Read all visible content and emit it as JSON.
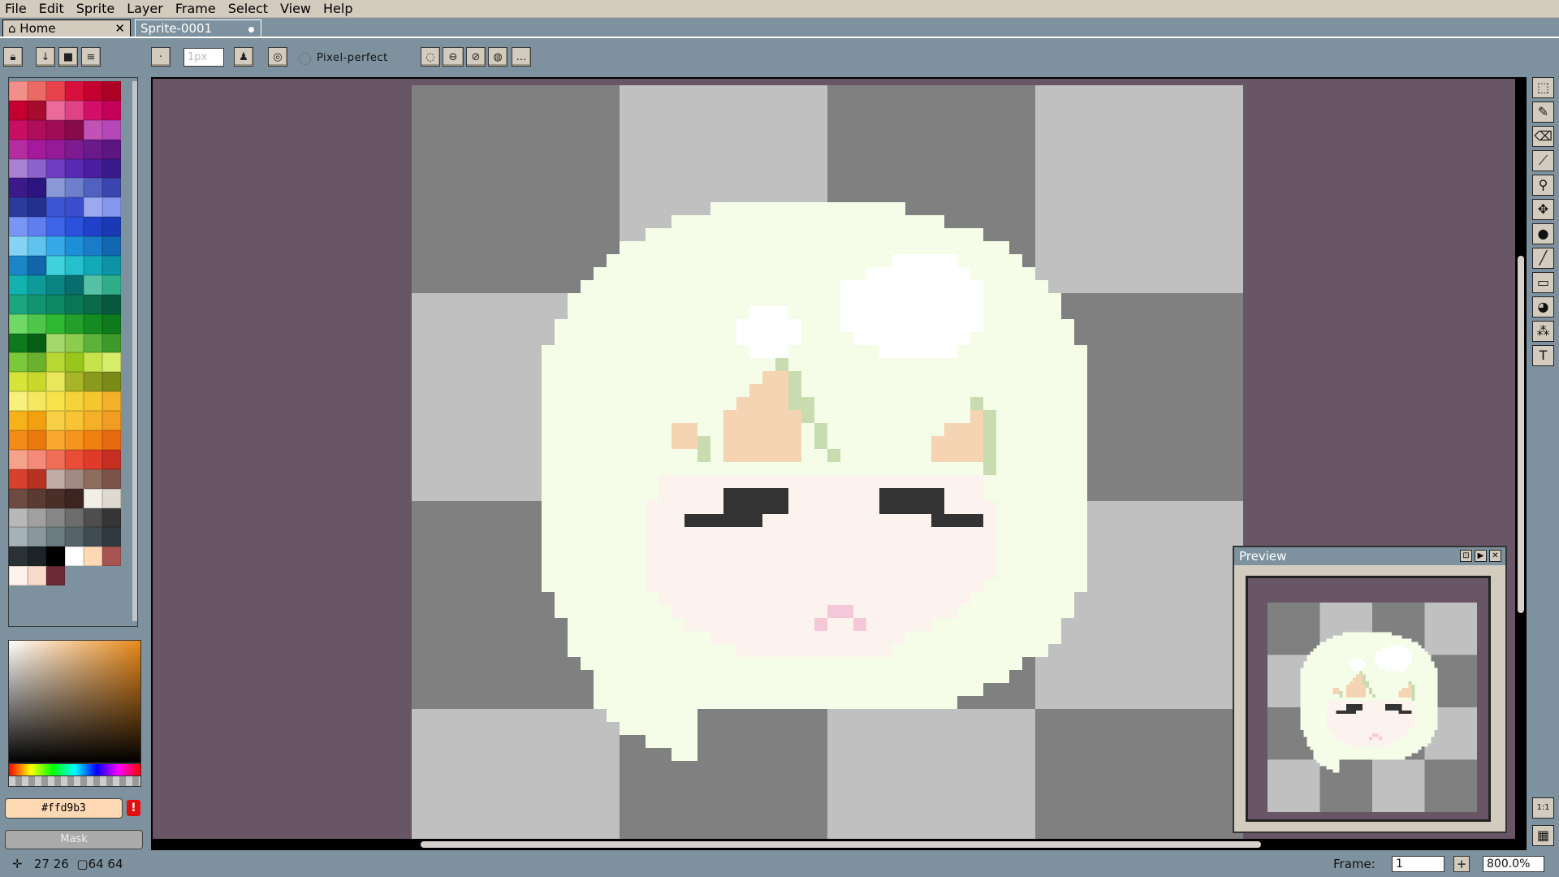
{
  "menu": [
    "File",
    "Edit",
    "Sprite",
    "Layer",
    "Frame",
    "Select",
    "View",
    "Help"
  ],
  "tabs": {
    "home": "Home",
    "home_close": "✕",
    "sprite": "Sprite-0001"
  },
  "toolbar": {
    "brush_size": "1px",
    "pixel_perfect": "Pixel-perfect",
    "lock_icon": "lock-icon",
    "more": "..."
  },
  "palette": {
    "colors": [
      "#f38f8a",
      "#ec6a66",
      "#e9424d",
      "#d9103b",
      "#c3002f",
      "#ac0024",
      "#c3002f",
      "#a70c2e",
      "#ec6a9a",
      "#e04286",
      "#d20f68",
      "#c3005a",
      "#c80f63",
      "#b00d5c",
      "#a00c56",
      "#870a4a",
      "#c152b6",
      "#b548b9",
      "#b52ca0",
      "#a5199c",
      "#941a98",
      "#7c1b92",
      "#6a1a8a",
      "#5c1582",
      "#a881d4",
      "#8b61cb",
      "#6f3dbf",
      "#5a29b3",
      "#4b1ea0",
      "#3c1a8a",
      "#3c1a8a",
      "#2d1580",
      "#8a98d8",
      "#6e7fcc",
      "#5061c0",
      "#3a45b0",
      "#2a3a9e",
      "#23318d",
      "#3c56d2",
      "#3a4ecb",
      "#9ba9ef",
      "#8596ef",
      "#7996f5",
      "#5f7ff0",
      "#3e64e8",
      "#2a50dc",
      "#2040c9",
      "#1a3ab5",
      "#86d4f3",
      "#5fc3ee",
      "#35a8e8",
      "#1c8fd6",
      "#1a7cc8",
      "#1166b0",
      "#1a86c8",
      "#1066a8",
      "#3fd2dc",
      "#24c0cc",
      "#12aab8",
      "#0d93a3",
      "#12b2b0",
      "#0e9a9a",
      "#0b8484",
      "#0a6d6d",
      "#55c2a5",
      "#2fae8a",
      "#1ca680",
      "#12966f",
      "#0d8a62",
      "#0a7856",
      "#0a6a4a",
      "#075a3e",
      "#70d866",
      "#4ec64a",
      "#2fb832",
      "#22a02a",
      "#148c22",
      "#0d7a1c",
      "#0d7a1c",
      "#085e14",
      "#a5d86a",
      "#8dcc4e",
      "#5cb33a",
      "#3e9a2a",
      "#7cc83c",
      "#6ab22e",
      "#b8d834",
      "#98c61c",
      "#c6e44a",
      "#d6ec6a",
      "#d6e43a",
      "#c8d82c",
      "#e8e65a",
      "#a8b42a",
      "#8a9a1c",
      "#7a8a16",
      "#f7f07a",
      "#f5e860",
      "#f8e24a",
      "#f4d43a",
      "#f6c630",
      "#f2b12c",
      "#f6b21a",
      "#f2a010",
      "#f7d046",
      "#f8c435",
      "#f5b028",
      "#f19c22",
      "#f28c16",
      "#ea7a10",
      "#f8a82a",
      "#f5941e",
      "#f08010",
      "#e66a0e",
      "#f7a28a",
      "#f58a78",
      "#f06e56",
      "#e94d38",
      "#e03a2a",
      "#c62e22",
      "#d6412e",
      "#b83222",
      "#bfaaa4",
      "#a08a82",
      "#8e6c5e",
      "#7a5448",
      "#6e4a40",
      "#5a3a32",
      "#4a2e28",
      "#3c2420",
      "#f2efe8",
      "#dedad2",
      "#b8b8b8",
      "#a0a0a0",
      "#868686",
      "#6c6c6c",
      "#4e4e4e",
      "#363636",
      "#a6b2b8",
      "#8a989e",
      "#6d7c82",
      "#56646a",
      "#404c52",
      "#2e3a40",
      "#2a3236",
      "#1c2428",
      "#000000",
      "#ffffff",
      "#ffd9b3",
      "#a85452",
      "#fdf2ec",
      "#f9d9c8",
      "#6a2a36"
    ],
    "hex_value": "#ffd9b3",
    "warn": "!",
    "mask_label": "Mask"
  },
  "tools": [
    "pencil-icon",
    "eraser-icon",
    "eyedropper-icon",
    "zoom-icon",
    "move-icon",
    "fill-icon",
    "line-icon",
    "rect-icon",
    "blur-icon",
    "spray-icon",
    "text-icon"
  ],
  "preview": {
    "title": "Preview"
  },
  "status": {
    "coords": "27 26",
    "size": "64 64",
    "frame_label": "Frame:",
    "frame_value": "1",
    "zoom": "800.0%"
  },
  "colors": {
    "ui_bg": "#7d929e",
    "ui_panel": "#d3cbbe",
    "canvas_bg": "#685565",
    "checker_dark": "#808080",
    "checker_light": "#c0c0c0",
    "hair": "#f5fde8",
    "skin": "#fdf3ee",
    "skin_shadow": "#f5d4b4",
    "hair_shadow": "#c8dcb0",
    "eyes": "#333333",
    "mouth": "#f4c8d8"
  }
}
